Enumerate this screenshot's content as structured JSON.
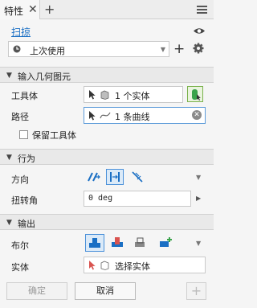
{
  "tab": {
    "label": "特性",
    "close": "✕",
    "add": "+"
  },
  "feature": {
    "title": "扫掠"
  },
  "preset": {
    "value": "上次使用"
  },
  "sections": {
    "input_geometry": {
      "title": "输入几何图元"
    },
    "behavior": {
      "title": "行为"
    },
    "output": {
      "title": "输出"
    }
  },
  "fields": {
    "tool_body": {
      "label": "工具体",
      "value": "1 个实体"
    },
    "path": {
      "label": "路径",
      "value": "1 条曲线"
    },
    "keep_tool": {
      "label": "保留工具体",
      "checked": false
    },
    "direction": {
      "label": "方向"
    },
    "twist_angle": {
      "label": "扭转角",
      "value": "0 deg"
    },
    "boolean": {
      "label": "布尔"
    },
    "body": {
      "label": "实体",
      "placeholder": "选择实体"
    }
  },
  "buttons": {
    "ok": "确定",
    "cancel": "取消",
    "add": "+"
  },
  "colors": {
    "accent": "#1a6fc4",
    "green": "#3aa34a",
    "red": "#d9534f"
  },
  "icons": [
    "close-icon",
    "eye-icon",
    "clock-icon",
    "gear-icon",
    "cursor-icon",
    "solid-body-icon",
    "curve-icon",
    "direction-icons",
    "boolean-icons",
    "clear-icon"
  ]
}
